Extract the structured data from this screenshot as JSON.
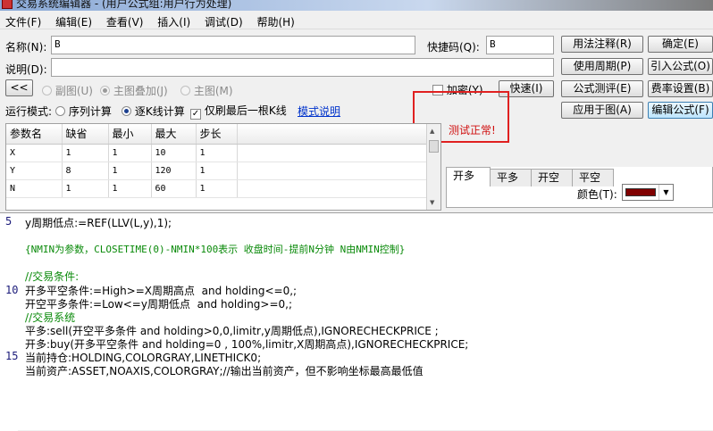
{
  "window": {
    "title": "交易系统编辑器 - (用户公式组:用户行为处理)"
  },
  "menu": [
    "文件(F)",
    "编辑(E)",
    "查看(V)",
    "插入(I)",
    "调试(D)",
    "帮助(H)"
  ],
  "fields": {
    "name_label": "名称(N):",
    "name_value": "B",
    "hotkey_label": "快捷码(Q):",
    "hotkey_value": "B",
    "desc_label": "说明(D):",
    "desc_value": ""
  },
  "buttons": {
    "usage_note": "用法注释(R)",
    "ok": "确定(E)",
    "use_period": "使用周期(P)",
    "import_formula": "引入公式(O)",
    "formula_test": "公式测评(E)",
    "fee_settings": "费率设置(B)",
    "apply_to_chart": "应用于图(A)",
    "edit_formula": "编辑公式(F)",
    "back": "<<",
    "quick": "快速(I)"
  },
  "chart_mode": {
    "sub": "副图(U)",
    "main_overlay": "主图叠加(J)",
    "main": "主图(M)"
  },
  "encrypt_label": "加密(Y)",
  "run_mode": {
    "label": "运行模式:",
    "sequence": "序列计算",
    "tick": "逐K线计算",
    "refresh_last": "仅刷最后一根K线",
    "mode_help": "模式说明"
  },
  "status_message": "测试正常!",
  "params": {
    "headers": [
      "参数名",
      "缺省",
      "最小",
      "最大",
      "步长"
    ],
    "rows": [
      [
        "X",
        "1",
        "1",
        "10",
        "1"
      ],
      [
        "Y",
        "8",
        "1",
        "120",
        "1"
      ],
      [
        "N",
        "1",
        "1",
        "60",
        "1"
      ]
    ]
  },
  "tabs": [
    "开多",
    "平多",
    "开空",
    "平空"
  ],
  "color_label": "颜色(T):",
  "color_value": "#800000",
  "code_lines": {
    "l1": "y周期低点:=REF(LLV(L,y),1);",
    "l2": "{NMIN为参数，CLOSETIME(0)-NMIN*100表示 收盘时间-提前N分钟 N由NMIN控制}",
    "l3": "//交易条件:",
    "l4": "开多平空条件:=High>=X周期高点  and holding<=0,;",
    "l5": "开空平多条件:=Low<=y周期低点  and holding>=0,;",
    "l6": "//交易系统",
    "l7": "平多:sell(开空平多条件 and holding>0,0,limitr,y周期低点),IGNORECHECKPRICE ;",
    "l8": "开多:buy(开多平空条件 and holding=0 , 100%,limitr,X周期高点),IGNORECHECKPRICE;",
    "l9": "当前持仓:HOLDING,COLORGRAY,LINETHICK0;",
    "l10": "当前资产:ASSET,NOAXIS,COLORGRAY;//输出当前资产，但不影响坐标最高最低值"
  },
  "line_numbers": {
    "n5": "5",
    "n10": "10",
    "n15": "15"
  }
}
